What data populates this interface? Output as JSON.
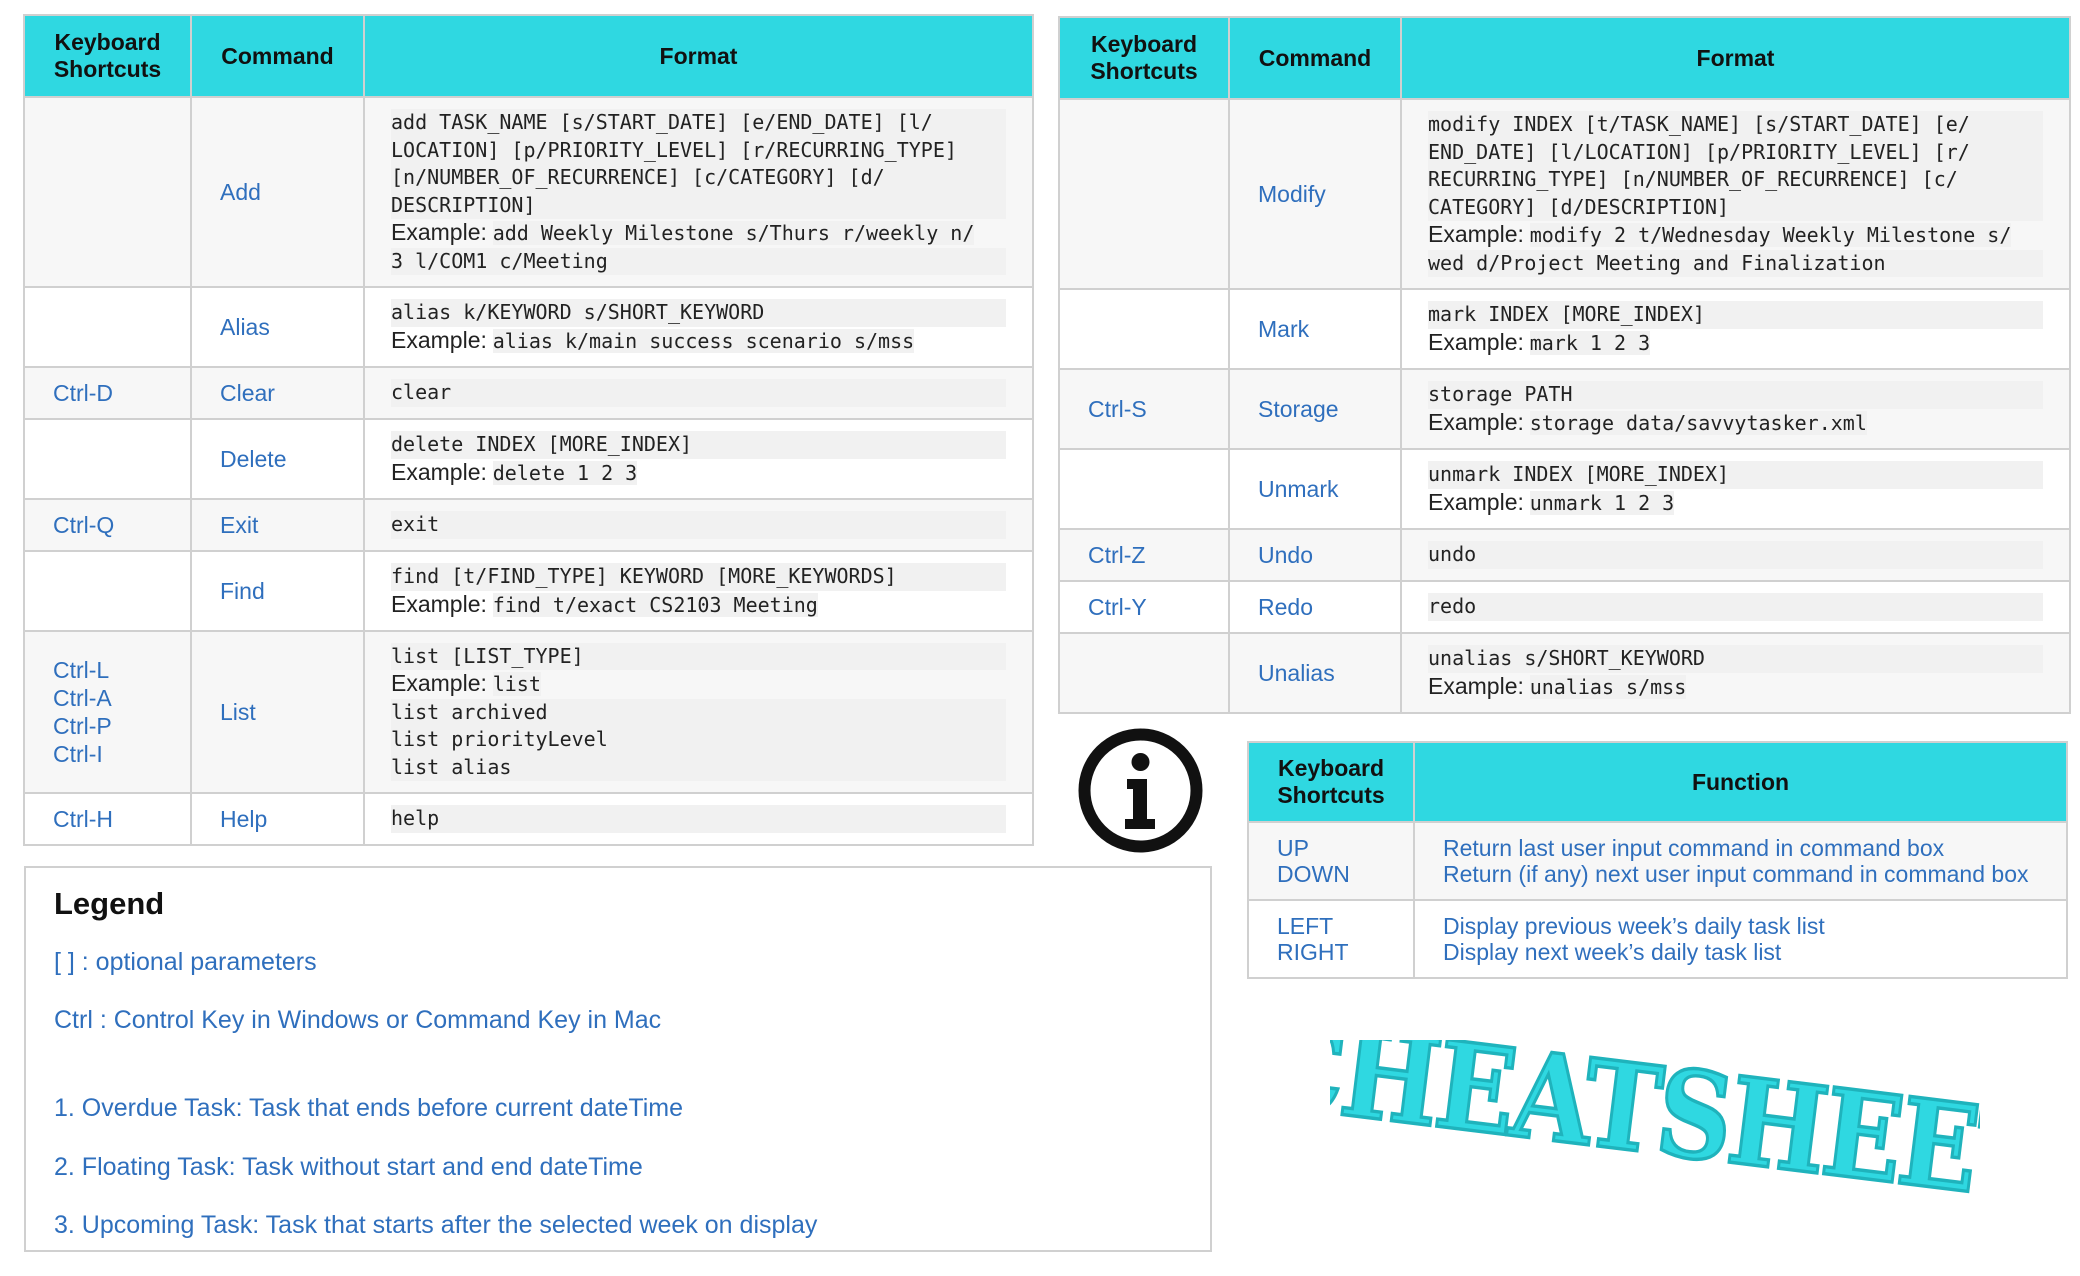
{
  "left_table": {
    "headers": [
      "Keyboard\nShortcuts",
      "Command",
      "Format"
    ],
    "rows": [
      {
        "shortcut": "",
        "command": "Add",
        "format": [
          "add TASK_NAME [s/START_DATE] [e/END_DATE] [l/",
          "LOCATION] [p/PRIORITY_LEVEL] [r/RECURRING_TYPE]",
          "[n/NUMBER_OF_RECURRENCE] [c/CATEGORY] [d/",
          "DESCRIPTION]"
        ],
        "example_label": "Example:",
        "example": [
          "add Weekly Milestone s/Thurs r/weekly n/",
          "3 l/COM1 c/Meeting"
        ]
      },
      {
        "shortcut": "",
        "command": "Alias",
        "format": [
          "alias k/KEYWORD s/SHORT_KEYWORD"
        ],
        "example_label": "Example:",
        "example": [
          "alias k/main success scenario s/mss"
        ]
      },
      {
        "shortcut": "Ctrl-D",
        "command": "Clear",
        "format": [
          "clear"
        ]
      },
      {
        "shortcut": "",
        "command": "Delete",
        "format": [
          "delete INDEX [MORE_INDEX]"
        ],
        "example_label": "Example:",
        "example": [
          "delete 1 2 3"
        ]
      },
      {
        "shortcut": "Ctrl-Q",
        "command": "Exit",
        "format": [
          "exit"
        ]
      },
      {
        "shortcut": "",
        "command": "Find",
        "format": [
          "find [t/FIND_TYPE] KEYWORD [MORE_KEYWORDS]"
        ],
        "example_label": "Example:",
        "example": [
          "find t/exact CS2103 Meeting"
        ]
      },
      {
        "shortcuts": [
          "Ctrl-L",
          "Ctrl-A",
          "Ctrl-P",
          "Ctrl-I"
        ],
        "command": "List",
        "format": [
          "list [LIST_TYPE]"
        ],
        "example_label": "Example:",
        "example": [
          "list",
          "list archived",
          "list priorityLevel",
          "list alias"
        ]
      },
      {
        "shortcut": "Ctrl-H",
        "command": "Help",
        "format": [
          "help"
        ]
      }
    ]
  },
  "right_table": {
    "headers": [
      "Keyboard\nShortcuts",
      "Command",
      "Format"
    ],
    "rows": [
      {
        "shortcut": "",
        "command": "Modify",
        "format": [
          "modify INDEX [t/TASK_NAME] [s/START_DATE] [e/",
          "END_DATE] [l/LOCATION] [p/PRIORITY_LEVEL] [r/",
          "RECURRING_TYPE] [n/NUMBER_OF_RECURRENCE] [c/",
          "CATEGORY] [d/DESCRIPTION]"
        ],
        "example_label": "Example:",
        "example": [
          "modify 2 t/Wednesday Weekly Milestone s/",
          "wed d/Project Meeting and Finalization"
        ]
      },
      {
        "shortcut": "",
        "command": "Mark",
        "format": [
          "mark INDEX [MORE_INDEX]"
        ],
        "example_label": "Example:",
        "example": [
          "mark 1 2 3"
        ]
      },
      {
        "shortcut": "Ctrl-S",
        "command": "Storage",
        "format": [
          "storage PATH"
        ],
        "example_label": "Example:",
        "example": [
          "storage data/savvytasker.xml"
        ]
      },
      {
        "shortcut": "",
        "command": "Unmark",
        "format": [
          "unmark INDEX [MORE_INDEX]"
        ],
        "example_label": "Example:",
        "example": [
          "unmark 1 2 3"
        ]
      },
      {
        "shortcut": "Ctrl-Z",
        "command": "Undo",
        "format": [
          "undo"
        ]
      },
      {
        "shortcut": "Ctrl-Y",
        "command": "Redo",
        "format": [
          "redo"
        ]
      },
      {
        "shortcut": "",
        "command": "Unalias",
        "format": [
          "unalias s/SHORT_KEYWORD"
        ],
        "example_label": "Example:",
        "example": [
          "unalias s/mss"
        ]
      }
    ]
  },
  "function_table": {
    "headers": [
      "Keyboard\nShortcuts",
      "Function"
    ],
    "rows": [
      {
        "keys": [
          "UP",
          "DOWN"
        ],
        "functions": [
          "Return last user input command in command box",
          "Return (if any) next user input command in command box"
        ]
      },
      {
        "keys": [
          "LEFT",
          "RIGHT"
        ],
        "functions": [
          "Display previous week’s daily task list",
          "Display next week’s daily task list"
        ]
      }
    ]
  },
  "legend": {
    "title": "Legend",
    "items": [
      "[ ] : optional parameters",
      "Ctrl : Control Key in Windows or Command Key in Mac",
      "1.  Overdue Task: Task that ends before current dateTime",
      "2.  Floating Task: Task without start and end dateTime",
      "3.  Upcoming Task: Task that starts after the selected week on display"
    ]
  },
  "stamp_text": "CHEATSHEET",
  "icons": {
    "info": "info-circle-icon"
  },
  "colors": {
    "header_bg": "#2fd8e1",
    "link_text": "#2f6fbd",
    "stamp": "#2fd8e1"
  }
}
